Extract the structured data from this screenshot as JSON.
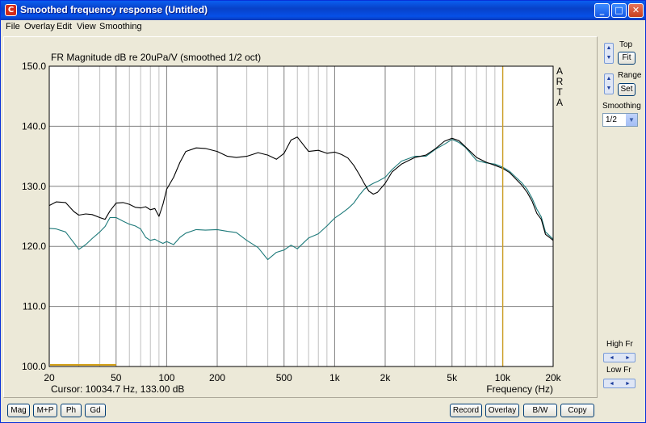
{
  "window": {
    "title": "Smoothed frequency response (Untitled)",
    "app_icon_letter": "C"
  },
  "title_buttons": {
    "minimize": "_",
    "maximize": "□",
    "close": "✕"
  },
  "menu": [
    "File",
    "Overlay",
    "Edit",
    "View",
    "Smoothing"
  ],
  "sidepanel": {
    "top_label": "Top",
    "fit_label": "Fit",
    "range_label": "Range",
    "set_label": "Set",
    "smoothing_label": "Smoothing",
    "smoothing_value": "1/2",
    "high_fr_label": "High Fr",
    "low_fr_label": "Low Fr",
    "spin_up": "▲",
    "spin_down": "▼",
    "spin_left": "◄",
    "spin_right": "►",
    "dropdown_arrow": "▼"
  },
  "bottom_left_buttons": [
    "Mag",
    "M+P",
    "Ph",
    "Gd"
  ],
  "bottom_right_buttons": [
    "Record",
    "Overlay",
    "B/W",
    "Copy"
  ],
  "chart_data": {
    "type": "line",
    "title": "FR Magnitude dB re 20uPa/V (smoothed 1/2 oct)",
    "watermark": "ARTA",
    "xlabel": "Frequency (Hz)",
    "x_scale": "log",
    "xlim": [
      20,
      20000
    ],
    "ylim": [
      100,
      150
    ],
    "x_ticks": [
      20,
      50,
      100,
      200,
      500,
      1000,
      2000,
      5000,
      10000,
      20000
    ],
    "x_tick_labels": [
      "20",
      "50",
      "100",
      "200",
      "500",
      "1k",
      "2k",
      "5k",
      "10k",
      "20k"
    ],
    "y_ticks": [
      100,
      110,
      120,
      130,
      140,
      150
    ],
    "y_tick_labels": [
      "100.0",
      "110.0",
      "120.0",
      "130.0",
      "140.0",
      "150.0"
    ],
    "grid": true,
    "cursor_text": "Cursor: 10034.7 Hz, 133.00 dB",
    "cursor_freq": 10034.7,
    "marker_range": [
      20,
      50
    ],
    "colors": {
      "series_black": "#000000",
      "series_teal": "#1e7a7a",
      "cursor": "#d4a017",
      "grid_major": "#808080",
      "grid_minor": "#c0c0c0",
      "marker": "#d4a017"
    },
    "series": [
      {
        "x": [
          20,
          22,
          25,
          28,
          30,
          33,
          36,
          40,
          43,
          46,
          50,
          55,
          60,
          65,
          70,
          75,
          80,
          85,
          90,
          95,
          100,
          110,
          120,
          130,
          150,
          170,
          200,
          230,
          260,
          300,
          350,
          400,
          450,
          500,
          550,
          600,
          700,
          800,
          900,
          1000,
          1100,
          1200,
          1300,
          1400,
          1500,
          1600,
          1700,
          1800,
          2000,
          2200,
          2500,
          3000,
          3500,
          4000,
          4500,
          5000,
          5500,
          6000,
          7000,
          8000,
          9000,
          10000,
          11000,
          12000,
          13000,
          14000,
          15000,
          16000,
          17000,
          18000,
          19000,
          20000
        ],
        "values": [
          126.8,
          127.4,
          127.3,
          125.8,
          125.2,
          125.4,
          125.3,
          124.8,
          124.5,
          125.9,
          127.2,
          127.3,
          127.0,
          126.5,
          126.4,
          126.6,
          126.1,
          126.3,
          125.0,
          127.0,
          129.5,
          131.5,
          134.0,
          135.8,
          136.4,
          136.3,
          135.8,
          135.0,
          134.8,
          135.0,
          135.6,
          135.2,
          134.5,
          135.5,
          137.7,
          138.2,
          135.8,
          136.0,
          135.5,
          135.7,
          135.3,
          134.7,
          133.5,
          132.0,
          130.5,
          129.2,
          128.7,
          129.0,
          130.5,
          132.4,
          133.7,
          134.8,
          135.2,
          136.3,
          137.5,
          138.0,
          137.6,
          136.6,
          134.8,
          134.0,
          133.5,
          133.0,
          132.3,
          131.2,
          130.2,
          129.0,
          127.5,
          125.5,
          124.5,
          122.0,
          121.5,
          121.0
        ]
      },
      {
        "x": [
          20,
          22,
          25,
          28,
          30,
          33,
          36,
          40,
          43,
          46,
          50,
          55,
          60,
          65,
          70,
          75,
          80,
          85,
          90,
          95,
          100,
          110,
          120,
          130,
          150,
          170,
          200,
          230,
          260,
          300,
          350,
          400,
          450,
          500,
          550,
          600,
          700,
          800,
          900,
          1000,
          1100,
          1200,
          1300,
          1400,
          1500,
          1600,
          1700,
          1800,
          2000,
          2200,
          2500,
          3000,
          3500,
          4000,
          4500,
          5000,
          5500,
          6000,
          7000,
          8000,
          9000,
          10000,
          11000,
          12000,
          13000,
          14000,
          15000,
          16000,
          17000,
          18000,
          19000,
          20000
        ],
        "values": [
          123.0,
          122.9,
          122.4,
          120.6,
          119.5,
          120.3,
          121.3,
          122.4,
          123.3,
          124.8,
          124.8,
          124.2,
          123.7,
          123.4,
          122.9,
          121.5,
          121.0,
          121.2,
          120.8,
          120.5,
          120.8,
          120.3,
          121.5,
          122.2,
          122.8,
          122.7,
          122.8,
          122.5,
          122.3,
          121.0,
          119.8,
          117.8,
          119.0,
          119.4,
          120.2,
          119.6,
          121.4,
          122.1,
          123.4,
          124.7,
          125.5,
          126.3,
          127.2,
          128.5,
          129.5,
          130.1,
          130.5,
          130.8,
          131.5,
          132.8,
          134.2,
          135.0,
          135.0,
          136.2,
          137.0,
          137.8,
          137.3,
          136.5,
          134.3,
          133.9,
          133.7,
          133.2,
          132.5,
          131.5,
          130.6,
          129.5,
          128.0,
          126.2,
          124.9,
          122.4,
          121.8,
          121.2
        ]
      }
    ]
  }
}
